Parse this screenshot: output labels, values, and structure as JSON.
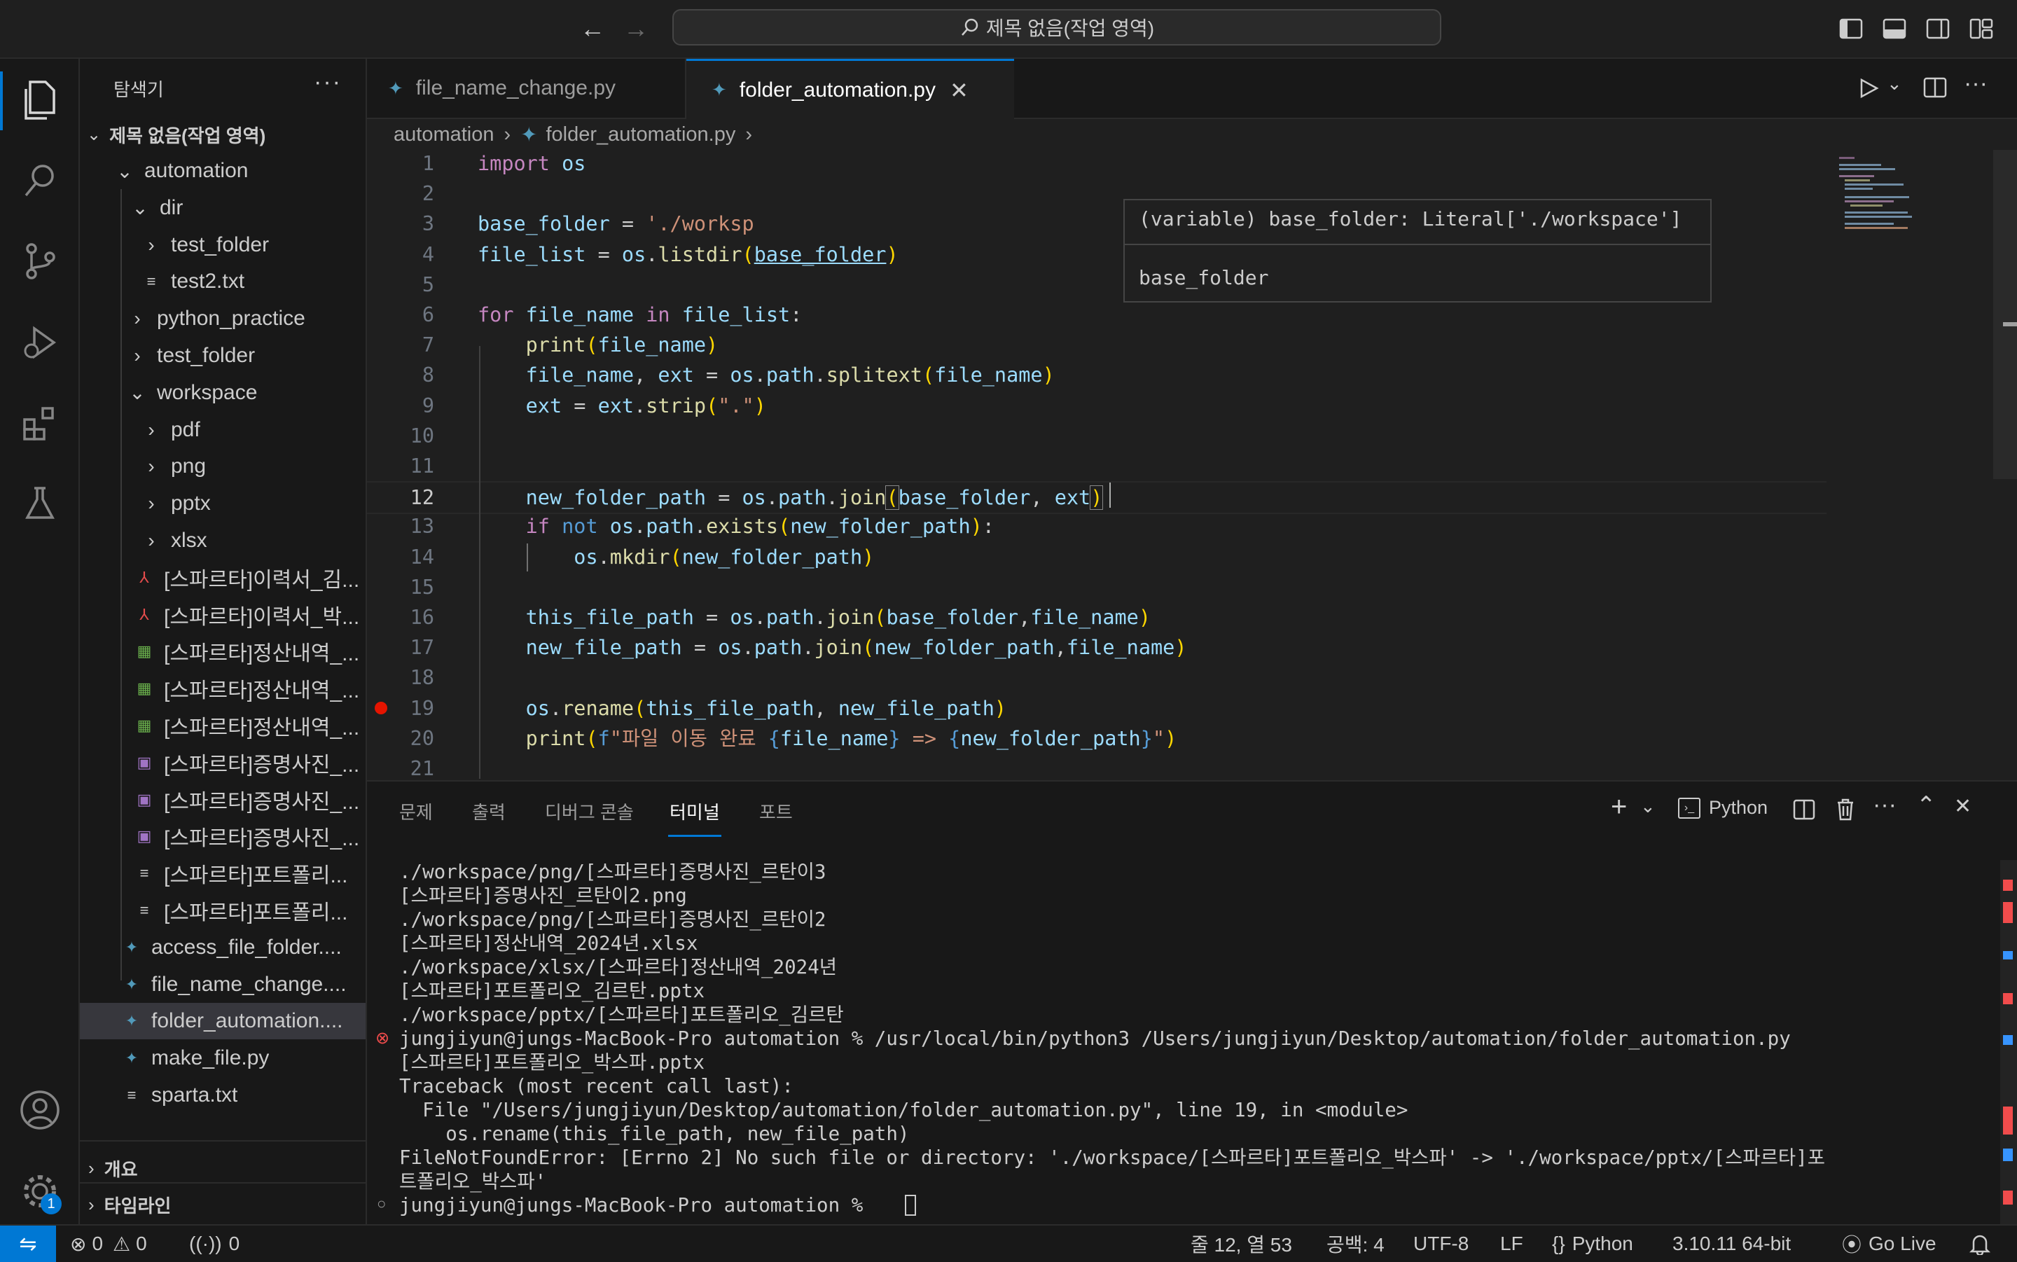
{
  "titlebar": {
    "search_text": "제목 없음(작업 영역)"
  },
  "sidebar": {
    "title": "탐색기",
    "workspace": "제목 없음(작업 영역)",
    "items": [
      {
        "label": "automation",
        "icon": "chevron-down"
      },
      {
        "label": "dir",
        "icon": "chevron-down"
      },
      {
        "label": "test_folder",
        "icon": "chevron-right"
      },
      {
        "label": "test2.txt",
        "icon": "text-file"
      },
      {
        "label": "python_practice",
        "icon": "chevron-right"
      },
      {
        "label": "test_folder",
        "icon": "chevron-right"
      },
      {
        "label": "workspace",
        "icon": "chevron-down"
      },
      {
        "label": "pdf",
        "icon": "chevron-right"
      },
      {
        "label": "png",
        "icon": "chevron-right"
      },
      {
        "label": "pptx",
        "icon": "chevron-right"
      },
      {
        "label": "xlsx",
        "icon": "chevron-right"
      },
      {
        "label": "[스파르타]이력서_김...",
        "icon": "pdf-file"
      },
      {
        "label": "[스파르타]이력서_박...",
        "icon": "pdf-file"
      },
      {
        "label": "[스파르타]정산내역_...",
        "icon": "excel-file"
      },
      {
        "label": "[스파르타]정산내역_...",
        "icon": "excel-file"
      },
      {
        "label": "[스파르타]정산내역_...",
        "icon": "excel-file"
      },
      {
        "label": "[스파르타]증명사진_...",
        "icon": "image-file"
      },
      {
        "label": "[스파르타]증명사진_...",
        "icon": "image-file"
      },
      {
        "label": "[스파르타]증명사진_...",
        "icon": "image-file"
      },
      {
        "label": "[스파르타]포트폴리...",
        "icon": "text-file"
      },
      {
        "label": "[스파르타]포트폴리...",
        "icon": "text-file"
      },
      {
        "label": "access_file_folder....",
        "icon": "python-file"
      },
      {
        "label": "file_name_change....",
        "icon": "python-file"
      },
      {
        "label": "folder_automation....",
        "icon": "python-file"
      },
      {
        "label": "make_file.py",
        "icon": "python-file"
      },
      {
        "label": "sparta.txt",
        "icon": "text-file"
      }
    ],
    "outline": "개요",
    "timeline": "타임라인"
  },
  "tabs": [
    {
      "label": "file_name_change.py",
      "active": false
    },
    {
      "label": "folder_automation.py",
      "active": true
    }
  ],
  "breadcrumb": [
    "automation",
    "folder_automation.py"
  ],
  "editor": {
    "line_numbers": [
      "1",
      "2",
      "3",
      "4",
      "5",
      "6",
      "7",
      "8",
      "9",
      "10",
      "11",
      "12",
      "13",
      "14",
      "15",
      "16",
      "17",
      "18",
      "19",
      "20",
      "21"
    ],
    "active_line": "12",
    "breakpoint_line": "19"
  },
  "hover": {
    "signature": "(variable) base_folder: Literal['./workspace']",
    "name": "base_folder"
  },
  "panel": {
    "tabs": [
      "문제",
      "출력",
      "디버그 콘솔",
      "터미널",
      "포트"
    ],
    "active_tab": "터미널",
    "terminal_profile": "Python",
    "terminal_lines": [
      "./workspace/png/[스파르타]증명사진_르탄이3",
      "[스파르타]증명사진_르탄이2.png",
      "./workspace/png/[스파르타]증명사진_르탄이2",
      "[스파르타]정산내역_2024년.xlsx",
      "./workspace/xlsx/[스파르타]정산내역_2024년",
      "[스파르타]포트폴리오_김르탄.pptx",
      "./workspace/pptx/[스파르타]포트폴리오_김르탄",
      "jungjiyun@jungs-MacBook-Pro automation % /usr/local/bin/python3 /Users/jungjiyun/Desktop/automation/folder_automation.py",
      "[스파르타]포트폴리오_박스파.pptx",
      "Traceback (most recent call last):",
      "  File \"/Users/jungjiyun/Desktop/automation/folder_automation.py\", line 19, in <module>",
      "    os.rename(this_file_path, new_file_path)",
      "FileNotFoundError: [Errno 2] No such file or directory: './workspace/[스파르타]포트폴리오_박스파' -> './workspace/pptx/[스파르타]포",
      "트폴리오_박스파'",
      "jungjiyun@jungs-MacBook-Pro automation % "
    ]
  },
  "statusbar": {
    "errors": "0",
    "warnings": "0",
    "ports": "0",
    "position": "줄 12, 열 53",
    "spaces": "공백: 4",
    "encoding": "UTF-8",
    "eol": "LF",
    "language": "Python",
    "interpreter": "3.10.11 64-bit",
    "golive": "Go Live"
  },
  "accounts_badge": "1",
  "colors": {
    "accent": "#0078d4",
    "breakpoint": "#e51400",
    "error": "#f14c4c"
  }
}
